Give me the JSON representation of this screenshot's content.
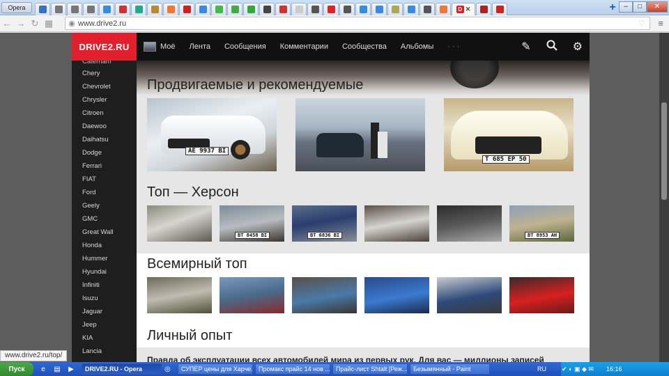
{
  "browser": {
    "menu_label": "Opera",
    "url": "www.drive2.ru",
    "status_url": "www.drive2.ru/top/",
    "tab_colors": [
      "#3b6fc4",
      "#777",
      "#777",
      "#777",
      "#3a8be0",
      "#c33",
      "#2a8",
      "#b83",
      "#e73",
      "#c22",
      "#3a8be0",
      "#4b4",
      "#4a4",
      "#3a3",
      "#444",
      "#c33",
      "#ccc",
      "#555",
      "#dd2222",
      "#555",
      "#3a8be0",
      "#3a8be0",
      "#aa5",
      "#3a8be0",
      "#555",
      "#e73",
      "#a22",
      "#c22"
    ],
    "active_tab_letter": "D",
    "active_tab_color": "#d62222",
    "new_tab_label": "+"
  },
  "site": {
    "logo": "DRIVE2.RU",
    "nav": [
      "Моё",
      "Лента",
      "Сообщения",
      "Комментарии",
      "Сообщества",
      "Альбомы",
      "· · ·"
    ],
    "icons": [
      "pencil-icon",
      "search-icon",
      "gear-icon"
    ]
  },
  "sidebar": {
    "cut_item": "Caterham",
    "items": [
      "Chery",
      "Chevrolet",
      "Chrysler",
      "Citroen",
      "Daewoo",
      "Daihatsu",
      "Dodge",
      "Ferrari",
      "FIAT",
      "Ford",
      "Geely",
      "GMC",
      "Great Wall",
      "Honda",
      "Hummer",
      "Hyundai",
      "Infiniti",
      "Isuzu",
      "Jaguar",
      "Jeep",
      "KIA",
      "Lancia"
    ]
  },
  "sections": {
    "promoted_title": "Продвигаемые и рекомендуемые",
    "promoted_plates": [
      "АЕ 9937 ВІ",
      "",
      "Т 685 ЕР 50"
    ],
    "kherson_title": "Топ — Херсон",
    "kherson_plates": [
      "",
      "ВТ 8458 ВІ",
      "ВТ 6836 ВІ",
      "",
      "",
      "ВТ 8953 АН"
    ],
    "world_title": "Всемирный топ",
    "experience_title": "Личный опыт",
    "experience_text": "Правда об эксплуатации всех автомобилей мира из первых рук. Для вас — миллионы записей"
  },
  "taskbar": {
    "start": "Пуск",
    "tasks": [
      "DRIVE2.RU - Opera",
      "СУПЕР цены для Харче...",
      "Промакс прайс 14 нов ...",
      "Прайс-лист Shtalt [Реж...",
      "Безымянный - Paint"
    ],
    "lang": "RU",
    "time": "16:16"
  }
}
